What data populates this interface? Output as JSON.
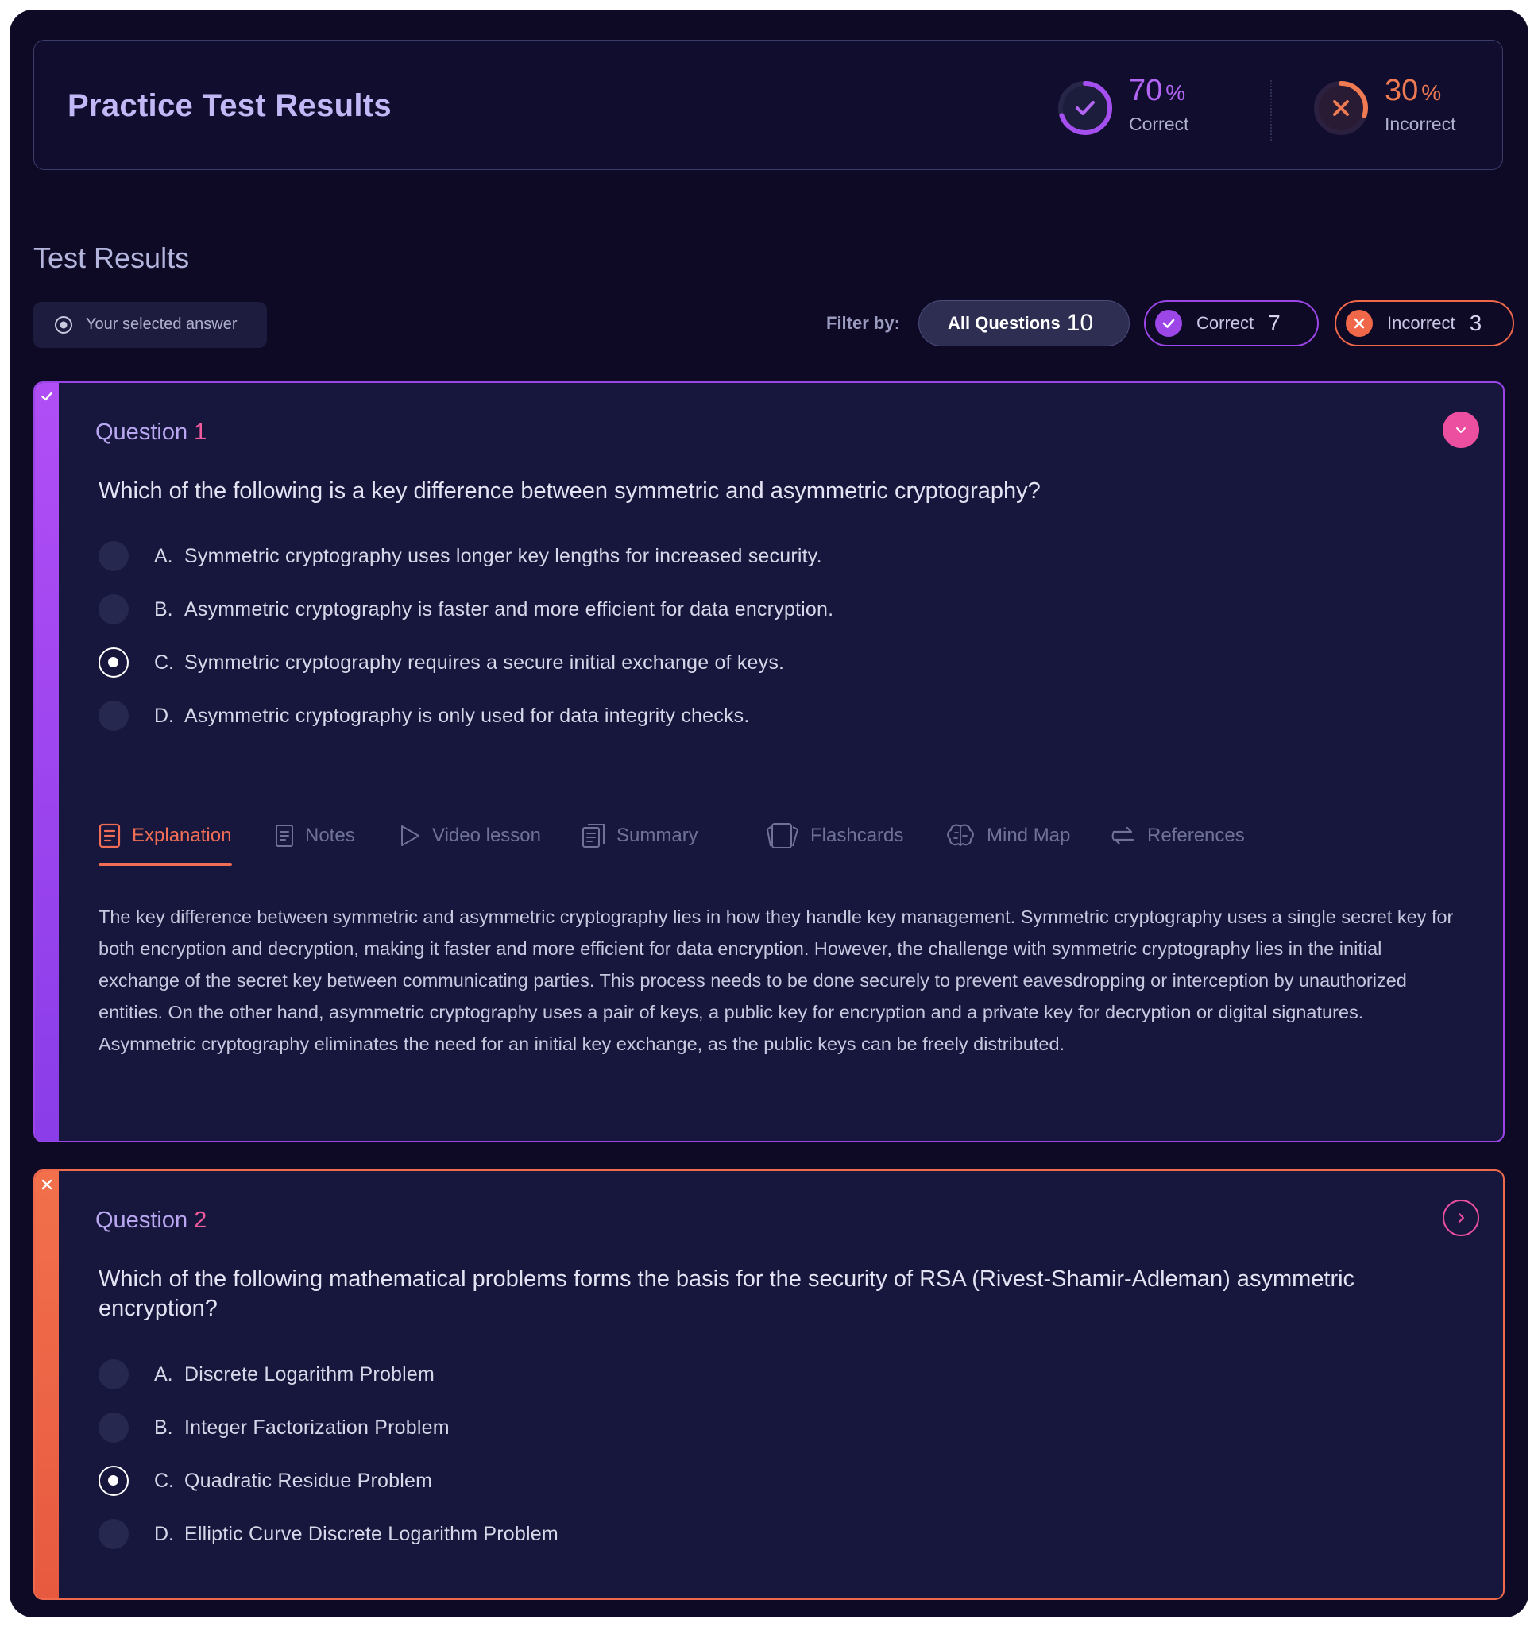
{
  "header": {
    "title": "Practice Test Results",
    "correct": {
      "value": "70",
      "unit": "%",
      "label": "Correct",
      "fraction": 0.7,
      "color": "#b264f3"
    },
    "incorrect": {
      "value": "30",
      "unit": "%",
      "label": "Incorrect",
      "fraction": 0.3,
      "color": "#f07a52"
    }
  },
  "results": {
    "title": "Test Results",
    "legend_label": "Your selected answer",
    "filter_label": "Filter by:",
    "filters": {
      "all": {
        "label": "All Questions",
        "count": "10"
      },
      "correct": {
        "label": "Correct",
        "count": "7"
      },
      "incorrect": {
        "label": "Incorrect",
        "count": "3"
      }
    }
  },
  "questions": [
    {
      "label": "Question",
      "number": "1",
      "status": "correct",
      "expanded": true,
      "text": "Which of the following is a key difference between symmetric and asymmetric cryptography?",
      "options": [
        {
          "letter": "A.",
          "text": "Symmetric cryptography uses longer key lengths for increased security.",
          "selected": false
        },
        {
          "letter": "B.",
          "text": "Asymmetric cryptography is faster and more efficient for data encryption.",
          "selected": false
        },
        {
          "letter": "C.",
          "text": "Symmetric cryptography requires a secure initial exchange of keys.",
          "selected": true
        },
        {
          "letter": "D.",
          "text": "Asymmetric cryptography is only used for data integrity checks.",
          "selected": false
        }
      ],
      "tabs": [
        {
          "label": "Explanation",
          "icon": "document-icon",
          "active": true
        },
        {
          "label": "Notes",
          "icon": "notes-icon",
          "active": false
        },
        {
          "label": "Video lesson",
          "icon": "play-icon",
          "active": false
        },
        {
          "label": "Summary",
          "icon": "summary-icon",
          "active": false
        },
        {
          "label": "Flashcards",
          "icon": "flashcards-icon",
          "active": false
        },
        {
          "label": "Mind Map",
          "icon": "brain-icon",
          "active": false
        },
        {
          "label": "References",
          "icon": "swap-arrows-icon",
          "active": false
        }
      ],
      "explanation": "The key difference between symmetric and asymmetric cryptography lies in how they handle key management. Symmetric cryptography uses a single secret key for both encryption and decryption, making it faster and more efficient for data encryption. However, the challenge with symmetric cryptography lies in the initial exchange of the secret key between communicating parties. This process needs to be done securely to prevent eavesdropping or interception by unauthorized entities. On the other hand, asymmetric cryptography uses a pair of keys, a public key for encryption and a private key for decryption or digital signatures. Asymmetric cryptography eliminates the need for an initial key exchange, as the public keys can be freely distributed."
    },
    {
      "label": "Question",
      "number": "2",
      "status": "incorrect",
      "expanded": false,
      "text": "Which of the following mathematical problems forms the basis for the security of RSA (Rivest-Shamir-Adleman) asymmetric encryption?",
      "options": [
        {
          "letter": "A.",
          "text": "Discrete Logarithm Problem",
          "selected": false
        },
        {
          "letter": "B.",
          "text": "Integer Factorization Problem",
          "selected": false
        },
        {
          "letter": "C.",
          "text": "Quadratic Residue Problem",
          "selected": true
        },
        {
          "letter": "D.",
          "text": "Elliptic Curve Discrete Logarithm Problem",
          "selected": false
        }
      ]
    }
  ]
}
